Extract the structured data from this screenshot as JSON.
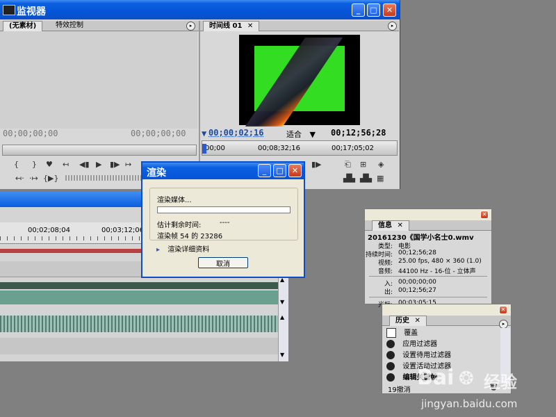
{
  "monitor": {
    "title": "监视器",
    "source_tabs": [
      "(无素材)",
      "特效控制"
    ],
    "program_tab": "时间线 01",
    "source_tc_in": "00;00;00;00",
    "source_tc_out": "00;00;00;00",
    "program_tc": "00;00;02;16",
    "fit_label": "适合",
    "program_duration": "00;12;56;28",
    "ruler": [
      "00;00",
      "00;08;32;16",
      "00;17;05;02"
    ]
  },
  "timeline": {
    "ruler": [
      "00;02;08;04",
      "00;03;12;06"
    ]
  },
  "render": {
    "title": "渲染",
    "rendering_label": "渲染媒体...",
    "progress": 0.0,
    "est_label": "估计剩余时间:",
    "est_value": "----",
    "frames_label": "渲染帧 54 的 23286",
    "details_label": "渲染详细资料",
    "cancel_label": "取消"
  },
  "info": {
    "tab": "信息",
    "filename": "20161230《国学小名士0.wmv",
    "rows": [
      {
        "label": "类型:",
        "value": "电影"
      },
      {
        "label": "持续时间:",
        "value": "00;12;56;28"
      },
      {
        "label": "视频:",
        "value": "25.00 fps, 480 × 360 (1.0)"
      },
      {
        "label": "音频:",
        "value": "44100 Hz - 16-位 - 立体声"
      },
      {
        "label": "入:",
        "value": "00;00;00;00"
      },
      {
        "label": "出:",
        "value": "00;12;56;27"
      },
      {
        "label": "光标:",
        "value": "00;03;05;15"
      }
    ]
  },
  "history": {
    "tab": "历史",
    "items": [
      "覆盖",
      "应用过滤器",
      "设置待用过滤器",
      "设置活动过滤器",
      "编辑关键帧"
    ],
    "undo_count": "19撤消"
  },
  "watermark": {
    "brand": "Bai",
    "brand2": "经验",
    "url": "jingyan.baidu.com"
  },
  "colors": {
    "xp_blue": "#0a5fe0",
    "green_screen": "#33dd22",
    "panel_gray": "#d6d6d6"
  }
}
